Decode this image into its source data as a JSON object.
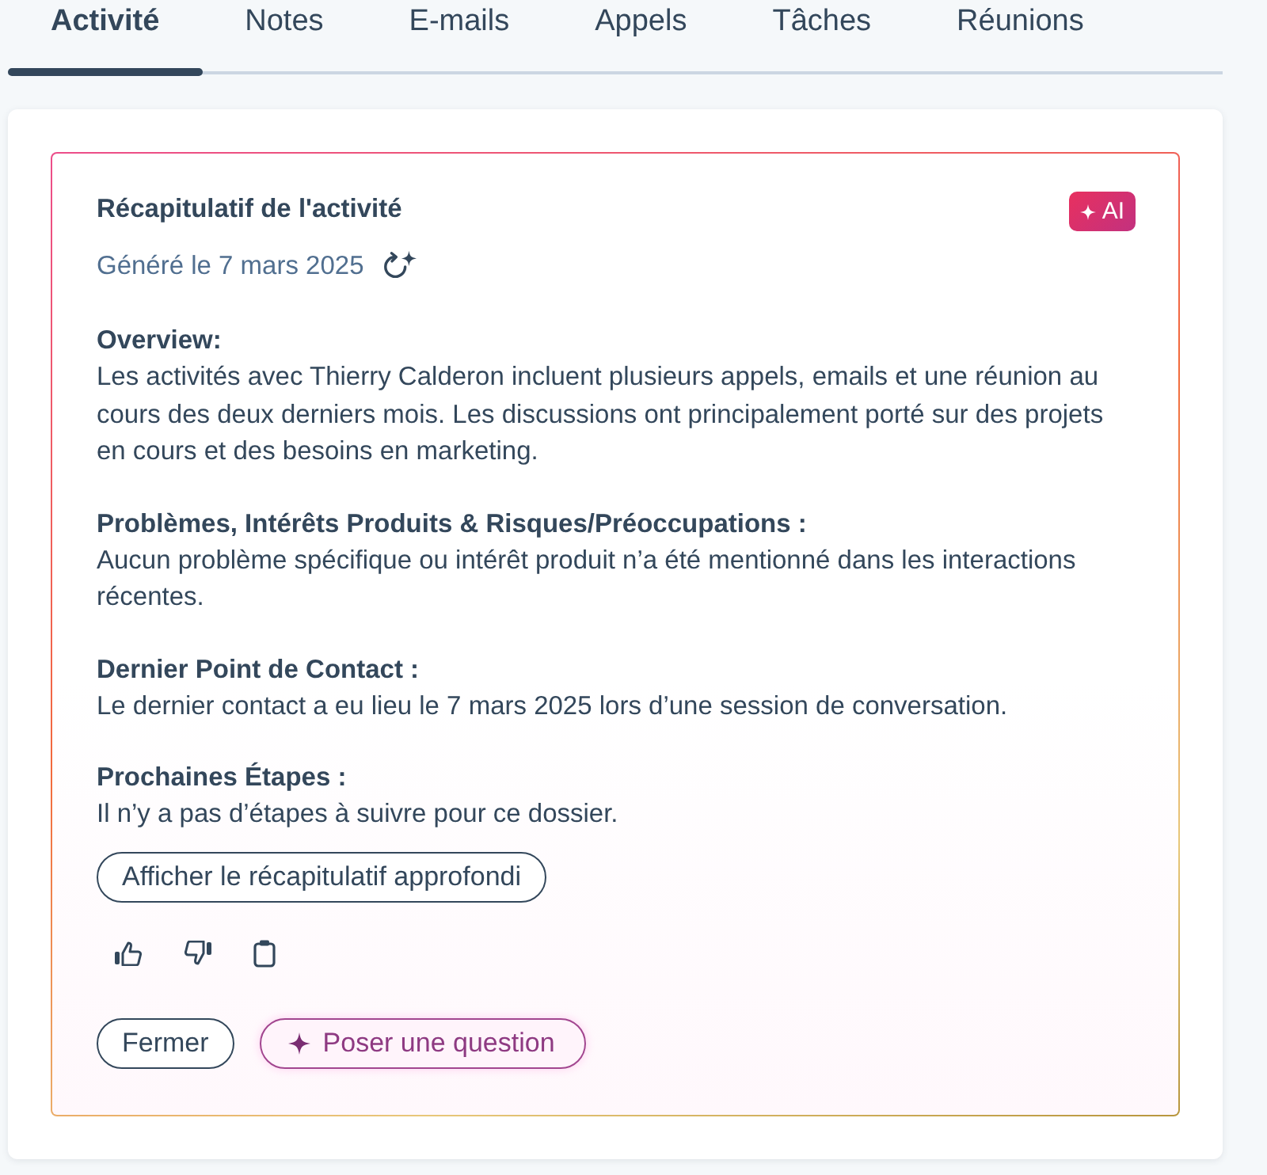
{
  "tabs": [
    {
      "label": "Activité",
      "selected": true
    },
    {
      "label": "Notes",
      "selected": false
    },
    {
      "label": "E-mails",
      "selected": false
    },
    {
      "label": "Appels",
      "selected": false
    },
    {
      "label": "Tâches",
      "selected": false
    },
    {
      "label": "Réunions",
      "selected": false
    }
  ],
  "summary": {
    "title": "Récapitulatif de l'activité",
    "badge": "AI",
    "generated": "Généré le 7 mars 2025",
    "sections": [
      {
        "heading": "Overview:",
        "text": "Les activités avec Thierry Calderon incluent plusieurs appels, emails et une réunion au cours des deux derniers mois. Les discussions ont principalement porté sur des projets en cours et des besoins en marketing."
      },
      {
        "heading": "Problèmes, Intérêts Produits & Risques/Préoccupations :",
        "text": "Aucun problème spécifique ou intérêt produit n’a été mentionné dans les interactions récentes."
      },
      {
        "heading": "Dernier Point de Contact :",
        "text": "Le dernier contact a eu lieu le 7 mars 2025 lors d’une session de conversation."
      },
      {
        "heading": "Prochaines Étapes :",
        "text": "Il n’y a pas d’étapes à suivre pour ce dossier."
      }
    ],
    "deep_summary_button": "Afficher le récapitulatif approfondi",
    "actions": [
      {
        "label": "Fermer",
        "kind": "plain"
      },
      {
        "label": "Poser une question",
        "kind": "ai"
      }
    ]
  }
}
